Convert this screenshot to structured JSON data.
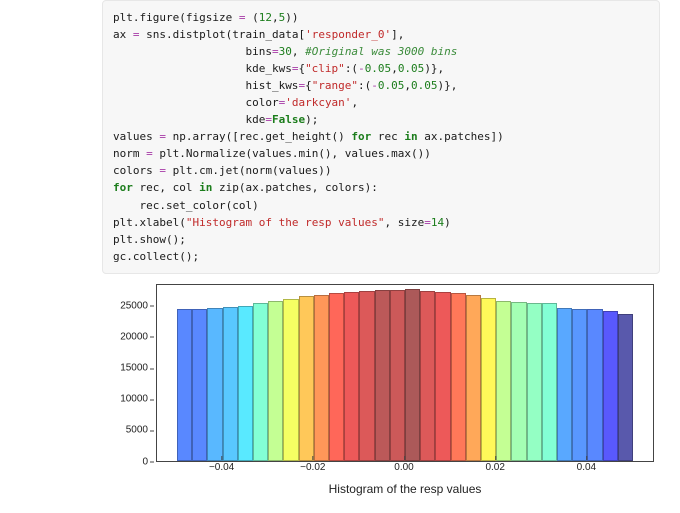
{
  "code": {
    "lines": [
      {
        "segs": [
          {
            "t": "plt.figure(figsize "
          },
          {
            "t": "=",
            "c": "op"
          },
          {
            "t": " ("
          },
          {
            "t": "12",
            "c": "num"
          },
          {
            "t": ","
          },
          {
            "t": "5",
            "c": "num"
          },
          {
            "t": "))"
          }
        ]
      },
      {
        "segs": [
          {
            "t": "ax "
          },
          {
            "t": "=",
            "c": "op"
          },
          {
            "t": " sns.distplot(train_data["
          },
          {
            "t": "'responder_0'",
            "c": "str"
          },
          {
            "t": "],"
          }
        ]
      },
      {
        "indent": 20,
        "segs": [
          {
            "t": "bins"
          },
          {
            "t": "=",
            "c": "op"
          },
          {
            "t": "30",
            "c": "num"
          },
          {
            "t": ", "
          },
          {
            "t": "#Original was 3000 bins",
            "c": "cm"
          }
        ]
      },
      {
        "indent": 20,
        "segs": [
          {
            "t": "kde_kws"
          },
          {
            "t": "=",
            "c": "op"
          },
          {
            "t": "{"
          },
          {
            "t": "\"clip\"",
            "c": "str"
          },
          {
            "t": ":("
          },
          {
            "t": "-",
            "c": "op"
          },
          {
            "t": "0.05",
            "c": "num"
          },
          {
            "t": ","
          },
          {
            "t": "0.05",
            "c": "num"
          },
          {
            "t": ")},"
          }
        ]
      },
      {
        "indent": 20,
        "segs": [
          {
            "t": "hist_kws"
          },
          {
            "t": "=",
            "c": "op"
          },
          {
            "t": "{"
          },
          {
            "t": "\"range\"",
            "c": "str"
          },
          {
            "t": ":("
          },
          {
            "t": "-",
            "c": "op"
          },
          {
            "t": "0.05",
            "c": "num"
          },
          {
            "t": ","
          },
          {
            "t": "0.05",
            "c": "num"
          },
          {
            "t": ")},"
          }
        ]
      },
      {
        "indent": 20,
        "segs": [
          {
            "t": "color"
          },
          {
            "t": "=",
            "c": "op"
          },
          {
            "t": "'darkcyan'",
            "c": "str"
          },
          {
            "t": ","
          }
        ]
      },
      {
        "indent": 20,
        "segs": [
          {
            "t": "kde"
          },
          {
            "t": "=",
            "c": "op"
          },
          {
            "t": "False",
            "c": "kw"
          },
          {
            "t": ");"
          }
        ]
      },
      {
        "segs": [
          {
            "t": "values "
          },
          {
            "t": "=",
            "c": "op"
          },
          {
            "t": " np.array([rec.get_height() "
          },
          {
            "t": "for",
            "c": "kw"
          },
          {
            "t": " rec "
          },
          {
            "t": "in",
            "c": "kw"
          },
          {
            "t": " ax.patches])"
          }
        ]
      },
      {
        "segs": [
          {
            "t": "norm "
          },
          {
            "t": "=",
            "c": "op"
          },
          {
            "t": " plt.Normalize(values.min(), values.max())"
          }
        ]
      },
      {
        "segs": [
          {
            "t": "colors "
          },
          {
            "t": "=",
            "c": "op"
          },
          {
            "t": " plt.cm.jet(norm(values))"
          }
        ]
      },
      {
        "segs": [
          {
            "t": "for",
            "c": "kw"
          },
          {
            "t": " rec, col "
          },
          {
            "t": "in",
            "c": "kw"
          },
          {
            "t": " zip(ax.patches, colors):"
          }
        ]
      },
      {
        "indent": 4,
        "segs": [
          {
            "t": "rec.set_color(col)"
          }
        ]
      },
      {
        "segs": [
          {
            "t": "plt.xlabel("
          },
          {
            "t": "\"Histogram of the resp values\"",
            "c": "str"
          },
          {
            "t": ", size"
          },
          {
            "t": "=",
            "c": "op"
          },
          {
            "t": "14",
            "c": "num"
          },
          {
            "t": ")"
          }
        ]
      },
      {
        "segs": [
          {
            "t": "plt.show();"
          }
        ]
      },
      {
        "segs": [
          {
            "t": "gc.collect();"
          }
        ]
      }
    ]
  },
  "chart_data": {
    "type": "bar",
    "title": "",
    "xlabel": "Histogram of the resp values",
    "ylabel": "",
    "xlim": [
      -0.05,
      0.05
    ],
    "ylim": [
      0,
      28500
    ],
    "yticks": [
      0,
      5000,
      10000,
      15000,
      20000,
      25000
    ],
    "xticks": [
      -0.04,
      -0.02,
      0.0,
      0.02,
      0.04
    ],
    "xtick_labels": [
      "−0.04",
      "−0.02",
      "0.00",
      "0.02",
      "0.04"
    ],
    "categories": [
      -0.0483,
      -0.045,
      -0.0417,
      -0.0383,
      -0.035,
      -0.0317,
      -0.0283,
      -0.025,
      -0.0217,
      -0.0183,
      -0.015,
      -0.0117,
      -0.0083,
      -0.005,
      -0.0017,
      0.0017,
      0.005,
      0.0083,
      0.0117,
      0.015,
      0.0183,
      0.0217,
      0.025,
      0.0283,
      0.0317,
      0.035,
      0.0383,
      0.0417,
      0.045,
      0.0483
    ],
    "values": [
      24500,
      24500,
      24800,
      24900,
      25100,
      25500,
      25900,
      26200,
      26600,
      26900,
      27200,
      27400,
      27500,
      27700,
      27600,
      27800,
      27500,
      27400,
      27100,
      26800,
      26300,
      25900,
      25700,
      25600,
      25500,
      24700,
      24600,
      24500,
      24200,
      23700
    ],
    "colormap": "jet"
  }
}
